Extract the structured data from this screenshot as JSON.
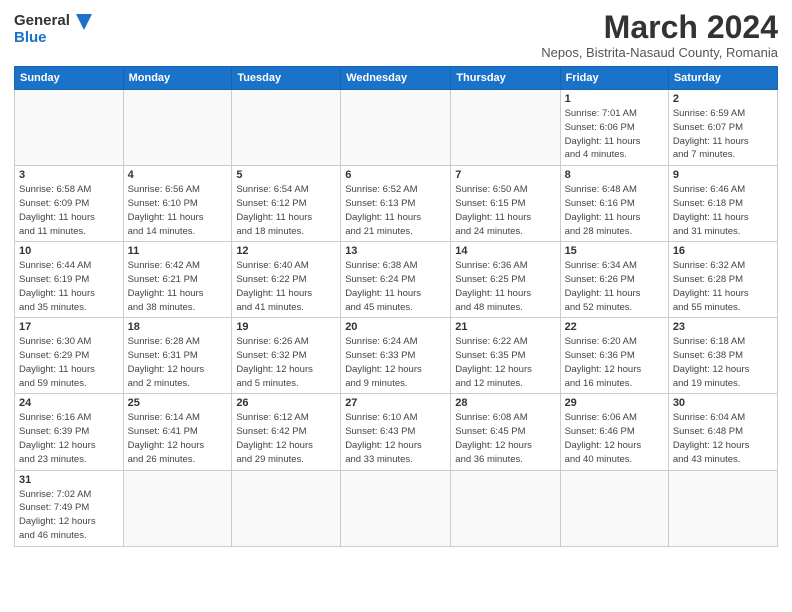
{
  "logo": {
    "line1": "General",
    "line2": "Blue"
  },
  "title": "March 2024",
  "subtitle": "Nepos, Bistrita-Nasaud County, Romania",
  "weekdays": [
    "Sunday",
    "Monday",
    "Tuesday",
    "Wednesday",
    "Thursday",
    "Friday",
    "Saturday"
  ],
  "weeks": [
    [
      {
        "day": "",
        "info": ""
      },
      {
        "day": "",
        "info": ""
      },
      {
        "day": "",
        "info": ""
      },
      {
        "day": "",
        "info": ""
      },
      {
        "day": "",
        "info": ""
      },
      {
        "day": "1",
        "info": "Sunrise: 7:01 AM\nSunset: 6:06 PM\nDaylight: 11 hours\nand 4 minutes."
      },
      {
        "day": "2",
        "info": "Sunrise: 6:59 AM\nSunset: 6:07 PM\nDaylight: 11 hours\nand 7 minutes."
      }
    ],
    [
      {
        "day": "3",
        "info": "Sunrise: 6:58 AM\nSunset: 6:09 PM\nDaylight: 11 hours\nand 11 minutes."
      },
      {
        "day": "4",
        "info": "Sunrise: 6:56 AM\nSunset: 6:10 PM\nDaylight: 11 hours\nand 14 minutes."
      },
      {
        "day": "5",
        "info": "Sunrise: 6:54 AM\nSunset: 6:12 PM\nDaylight: 11 hours\nand 18 minutes."
      },
      {
        "day": "6",
        "info": "Sunrise: 6:52 AM\nSunset: 6:13 PM\nDaylight: 11 hours\nand 21 minutes."
      },
      {
        "day": "7",
        "info": "Sunrise: 6:50 AM\nSunset: 6:15 PM\nDaylight: 11 hours\nand 24 minutes."
      },
      {
        "day": "8",
        "info": "Sunrise: 6:48 AM\nSunset: 6:16 PM\nDaylight: 11 hours\nand 28 minutes."
      },
      {
        "day": "9",
        "info": "Sunrise: 6:46 AM\nSunset: 6:18 PM\nDaylight: 11 hours\nand 31 minutes."
      }
    ],
    [
      {
        "day": "10",
        "info": "Sunrise: 6:44 AM\nSunset: 6:19 PM\nDaylight: 11 hours\nand 35 minutes."
      },
      {
        "day": "11",
        "info": "Sunrise: 6:42 AM\nSunset: 6:21 PM\nDaylight: 11 hours\nand 38 minutes."
      },
      {
        "day": "12",
        "info": "Sunrise: 6:40 AM\nSunset: 6:22 PM\nDaylight: 11 hours\nand 41 minutes."
      },
      {
        "day": "13",
        "info": "Sunrise: 6:38 AM\nSunset: 6:24 PM\nDaylight: 11 hours\nand 45 minutes."
      },
      {
        "day": "14",
        "info": "Sunrise: 6:36 AM\nSunset: 6:25 PM\nDaylight: 11 hours\nand 48 minutes."
      },
      {
        "day": "15",
        "info": "Sunrise: 6:34 AM\nSunset: 6:26 PM\nDaylight: 11 hours\nand 52 minutes."
      },
      {
        "day": "16",
        "info": "Sunrise: 6:32 AM\nSunset: 6:28 PM\nDaylight: 11 hours\nand 55 minutes."
      }
    ],
    [
      {
        "day": "17",
        "info": "Sunrise: 6:30 AM\nSunset: 6:29 PM\nDaylight: 11 hours\nand 59 minutes."
      },
      {
        "day": "18",
        "info": "Sunrise: 6:28 AM\nSunset: 6:31 PM\nDaylight: 12 hours\nand 2 minutes."
      },
      {
        "day": "19",
        "info": "Sunrise: 6:26 AM\nSunset: 6:32 PM\nDaylight: 12 hours\nand 5 minutes."
      },
      {
        "day": "20",
        "info": "Sunrise: 6:24 AM\nSunset: 6:33 PM\nDaylight: 12 hours\nand 9 minutes."
      },
      {
        "day": "21",
        "info": "Sunrise: 6:22 AM\nSunset: 6:35 PM\nDaylight: 12 hours\nand 12 minutes."
      },
      {
        "day": "22",
        "info": "Sunrise: 6:20 AM\nSunset: 6:36 PM\nDaylight: 12 hours\nand 16 minutes."
      },
      {
        "day": "23",
        "info": "Sunrise: 6:18 AM\nSunset: 6:38 PM\nDaylight: 12 hours\nand 19 minutes."
      }
    ],
    [
      {
        "day": "24",
        "info": "Sunrise: 6:16 AM\nSunset: 6:39 PM\nDaylight: 12 hours\nand 23 minutes."
      },
      {
        "day": "25",
        "info": "Sunrise: 6:14 AM\nSunset: 6:41 PM\nDaylight: 12 hours\nand 26 minutes."
      },
      {
        "day": "26",
        "info": "Sunrise: 6:12 AM\nSunset: 6:42 PM\nDaylight: 12 hours\nand 29 minutes."
      },
      {
        "day": "27",
        "info": "Sunrise: 6:10 AM\nSunset: 6:43 PM\nDaylight: 12 hours\nand 33 minutes."
      },
      {
        "day": "28",
        "info": "Sunrise: 6:08 AM\nSunset: 6:45 PM\nDaylight: 12 hours\nand 36 minutes."
      },
      {
        "day": "29",
        "info": "Sunrise: 6:06 AM\nSunset: 6:46 PM\nDaylight: 12 hours\nand 40 minutes."
      },
      {
        "day": "30",
        "info": "Sunrise: 6:04 AM\nSunset: 6:48 PM\nDaylight: 12 hours\nand 43 minutes."
      }
    ],
    [
      {
        "day": "31",
        "info": "Sunrise: 7:02 AM\nSunset: 7:49 PM\nDaylight: 12 hours\nand 46 minutes."
      },
      {
        "day": "",
        "info": ""
      },
      {
        "day": "",
        "info": ""
      },
      {
        "day": "",
        "info": ""
      },
      {
        "day": "",
        "info": ""
      },
      {
        "day": "",
        "info": ""
      },
      {
        "day": "",
        "info": ""
      }
    ]
  ]
}
